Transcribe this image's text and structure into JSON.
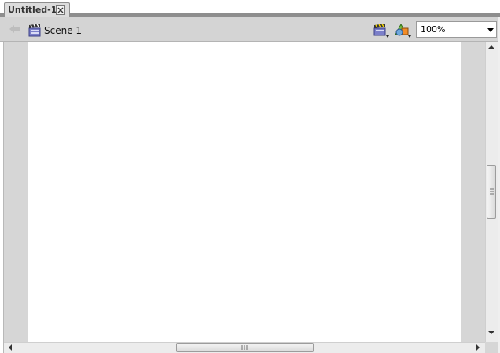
{
  "document_tab": {
    "title": "Untitled-1"
  },
  "edit_bar": {
    "scene_name": "Scene 1",
    "zoom": {
      "selected": "100%"
    }
  },
  "icons": {
    "tab_close": "close-icon",
    "back": "back-arrow-icon",
    "scene": "clapperboard-icon",
    "edit_scene": "edit-scene-icon",
    "edit_symbols": "edit-symbols-icon"
  },
  "colors": {
    "stage": "#ffffff",
    "pasteboard": "#d6d6d6",
    "toolbar": "#d4d4d4"
  }
}
